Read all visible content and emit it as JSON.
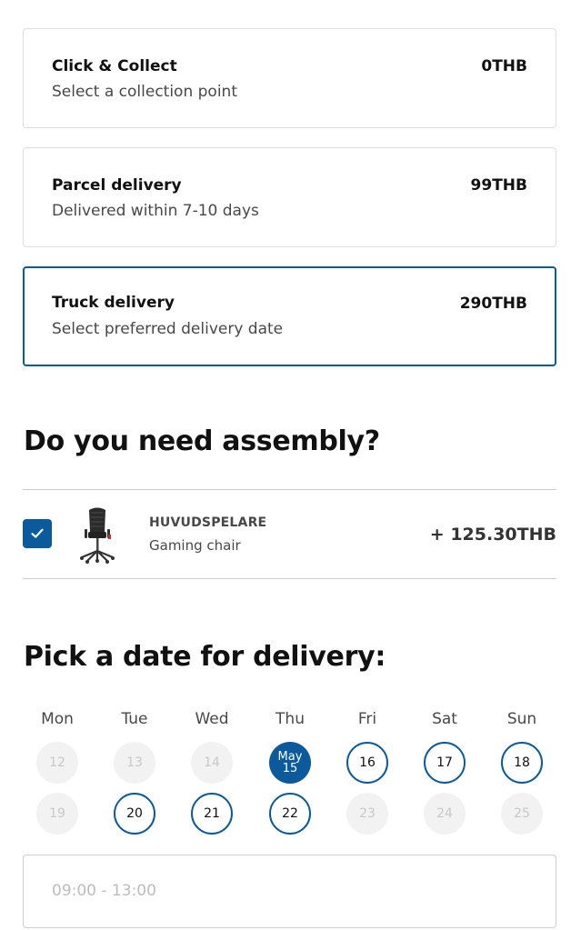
{
  "delivery_options": [
    {
      "title": "Click & Collect",
      "subtitle": "Select a collection point",
      "price": "0THB"
    },
    {
      "title": "Parcel delivery",
      "subtitle": "Delivered within 7-10 days",
      "price": "99THB"
    },
    {
      "title": "Truck delivery",
      "subtitle": "Select preferred delivery date",
      "price": "290THB",
      "selected": true
    }
  ],
  "assembly": {
    "heading": "Do you need assembly?",
    "checked": true,
    "product": {
      "name": "HUVUDSPELARE",
      "type": "Gaming chair",
      "price": "+ 125.30THB"
    }
  },
  "date_picker": {
    "heading": "Pick a date for delivery:",
    "weekdays": [
      "Mon",
      "Tue",
      "Wed",
      "Thu",
      "Fri",
      "Sat",
      "Sun"
    ],
    "weeks": [
      [
        {
          "day": "12",
          "state": "disabled"
        },
        {
          "day": "13",
          "state": "disabled"
        },
        {
          "day": "14",
          "state": "disabled"
        },
        {
          "day": "15",
          "month": "May",
          "state": "selected"
        },
        {
          "day": "16",
          "state": "available"
        },
        {
          "day": "17",
          "state": "available"
        },
        {
          "day": "18",
          "state": "available"
        }
      ],
      [
        {
          "day": "19",
          "state": "disabled"
        },
        {
          "day": "20",
          "state": "available"
        },
        {
          "day": "21",
          "state": "available"
        },
        {
          "day": "22",
          "state": "available"
        },
        {
          "day": "23",
          "state": "disabled"
        },
        {
          "day": "24",
          "state": "disabled"
        },
        {
          "day": "25",
          "state": "disabled"
        }
      ]
    ],
    "time_slot_placeholder": "09:00 - 13:00"
  },
  "colors": {
    "accent": "#0a5a9c",
    "disabled_bg": "#f2f2f2"
  }
}
